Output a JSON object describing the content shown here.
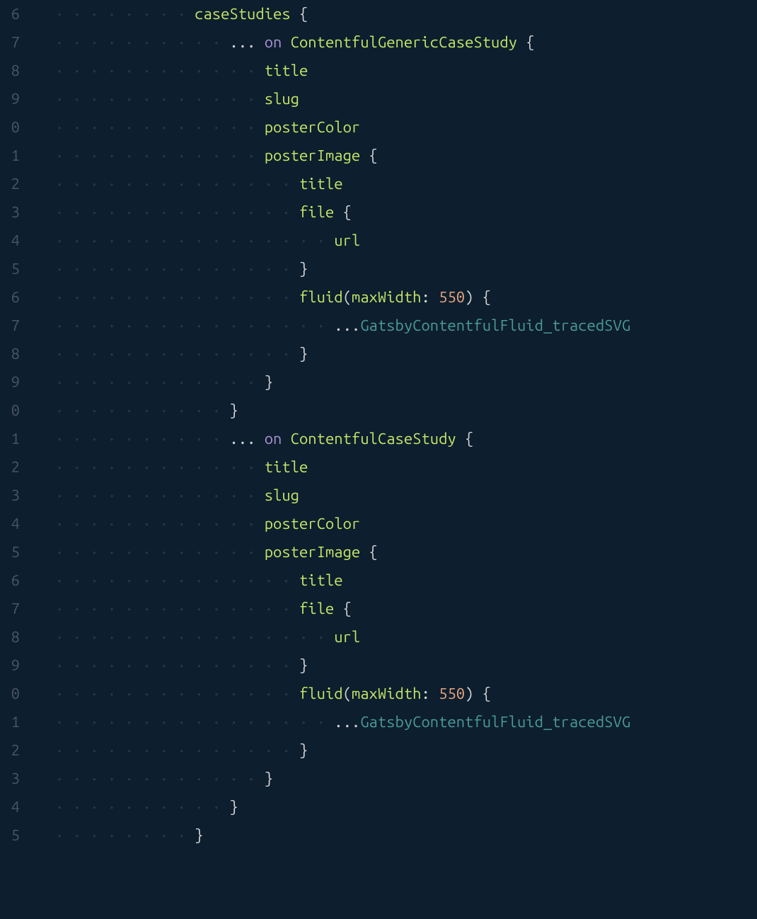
{
  "lineNumbers": [
    "6",
    "7",
    "8",
    "9",
    "0",
    "1",
    "2",
    "3",
    "4",
    "5",
    "6",
    "7",
    "8",
    "9",
    "0",
    "1",
    "2",
    "3",
    "4",
    "5",
    "6",
    "7",
    "8",
    "9",
    "0",
    "1",
    "2",
    "3",
    "4",
    "5"
  ],
  "lines": {
    "l0": {
      "indent": "· · · · · · · · ",
      "field": "caseStudies",
      "space": " ",
      "brace": "{"
    },
    "l1": {
      "indent": "· · · · · · · · · · ",
      "spread": "...",
      "space1": " ",
      "on": "on",
      "space2": " ",
      "type": "ContentfulGenericCaseStudy",
      "space3": " ",
      "brace": "{"
    },
    "l2": {
      "indent": "· · · · · · · · · · · · ",
      "field": "title"
    },
    "l3": {
      "indent": "· · · · · · · · · · · · ",
      "field": "slug"
    },
    "l4": {
      "indent": "· · · · · · · · · · · · ",
      "field": "posterColor"
    },
    "l5": {
      "indent": "· · · · · · · · · · · · ",
      "field": "posterImage",
      "space": " ",
      "brace": "{"
    },
    "l6": {
      "indent": "· · · · · · · · · · · · · · ",
      "field": "title"
    },
    "l7": {
      "indent": "· · · · · · · · · · · · · · ",
      "field": "file",
      "space": " ",
      "brace": "{"
    },
    "l8": {
      "indent": "· · · · · · · · · · · · · · · · ",
      "field": "url"
    },
    "l9": {
      "indent": "· · · · · · · · · · · · · · ",
      "brace": "}"
    },
    "l10": {
      "indent": "· · · · · · · · · · · · · · ",
      "field": "fluid",
      "lparen": "(",
      "arg": "maxWidth",
      "colon": ":",
      "space": " ",
      "num": "550",
      "rparen": ")",
      "space2": " ",
      "brace": "{"
    },
    "l11": {
      "indent": "· · · · · · · · · · · · · · · · ",
      "spread": "...",
      "frag": "GatsbyContentfulFluid_tracedSVG"
    },
    "l12": {
      "indent": "· · · · · · · · · · · · · · ",
      "brace": "}"
    },
    "l13": {
      "indent": "· · · · · · · · · · · · ",
      "brace": "}"
    },
    "l14": {
      "indent": "· · · · · · · · · · ",
      "brace": "}"
    },
    "l15": {
      "indent": "· · · · · · · · · · ",
      "spread": "...",
      "space1": " ",
      "on": "on",
      "space2": " ",
      "type": "ContentfulCaseStudy",
      "space3": " ",
      "brace": "{"
    },
    "l16": {
      "indent": "· · · · · · · · · · · · ",
      "field": "title"
    },
    "l17": {
      "indent": "· · · · · · · · · · · · ",
      "field": "slug"
    },
    "l18": {
      "indent": "· · · · · · · · · · · · ",
      "field": "posterColor"
    },
    "l19": {
      "indent": "· · · · · · · · · · · · ",
      "field": "posterImage",
      "space": " ",
      "brace": "{"
    },
    "l20": {
      "indent": "· · · · · · · · · · · · · · ",
      "field": "title"
    },
    "l21": {
      "indent": "· · · · · · · · · · · · · · ",
      "field": "file",
      "space": " ",
      "brace": "{"
    },
    "l22": {
      "indent": "· · · · · · · · · · · · · · · · ",
      "field": "url"
    },
    "l23": {
      "indent": "· · · · · · · · · · · · · · ",
      "brace": "}"
    },
    "l24": {
      "indent": "· · · · · · · · · · · · · · ",
      "field": "fluid",
      "lparen": "(",
      "arg": "maxWidth",
      "colon": ":",
      "space": " ",
      "num": "550",
      "rparen": ")",
      "space2": " ",
      "brace": "{"
    },
    "l25": {
      "indent": "· · · · · · · · · · · · · · · · ",
      "spread": "...",
      "frag": "GatsbyContentfulFluid_tracedSVG"
    },
    "l26": {
      "indent": "· · · · · · · · · · · · · · ",
      "brace": "}"
    },
    "l27": {
      "indent": "· · · · · · · · · · · · ",
      "brace": "}"
    },
    "l28": {
      "indent": "· · · · · · · · · · ",
      "brace": "}"
    },
    "l29": {
      "indent": "· · · · · · · · ",
      "brace": "}"
    }
  }
}
